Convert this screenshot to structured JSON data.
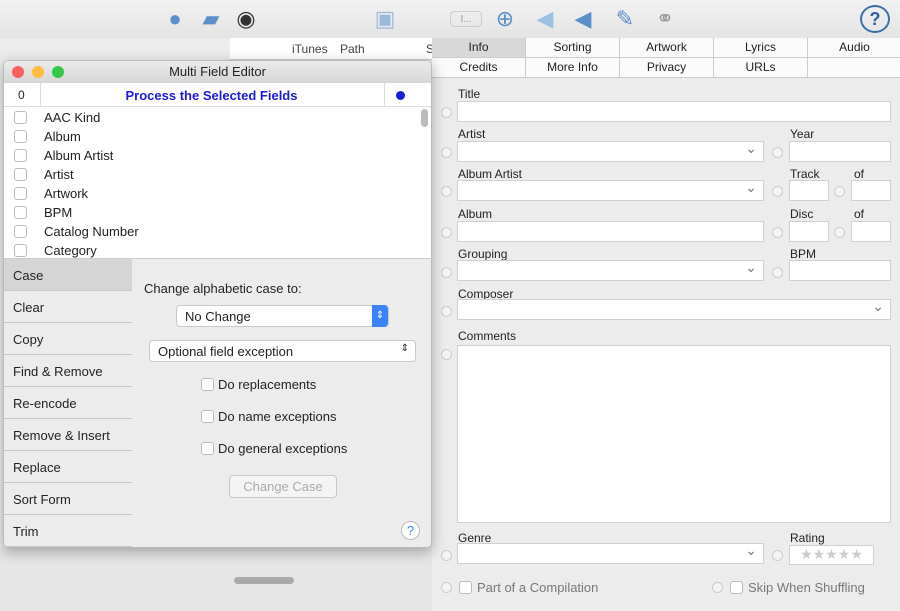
{
  "toolbar": {
    "icons": [
      "globe-icon",
      "folder-icon",
      "cd-icon",
      "save-icon",
      "field-icon",
      "zoom-icon",
      "megaphone-icon",
      "megaphone-edit-icon",
      "pencil-icon",
      "link-icon",
      "help-icon"
    ],
    "field_label": "I..."
  },
  "list_header": {
    "columns": [
      "iTunes",
      "Path",
      "S"
    ]
  },
  "tabs": {
    "row1": [
      "Info",
      "Sorting",
      "Artwork",
      "Lyrics",
      "Audio"
    ],
    "row2": [
      "Credits",
      "More Info",
      "Privacy",
      "URLs"
    ],
    "selected": "Info"
  },
  "info": {
    "title": "Title",
    "artist": "Artist",
    "year": "Year",
    "album_artist": "Album Artist",
    "track": "Track",
    "of1": "of",
    "album": "Album",
    "disc": "Disc",
    "of2": "of",
    "grouping": "Grouping",
    "bpm": "BPM",
    "composer": "Composer",
    "comments": "Comments",
    "genre": "Genre",
    "rating": "Rating",
    "stars": "★★★★★",
    "compilation": "Part of a Compilation",
    "skip": "Skip When Shuffling"
  },
  "dialog": {
    "title": "Multi Field Editor",
    "count": "0",
    "process": "Process the Selected Fields",
    "process_color": "#1a1adb",
    "fields": [
      "AAC Kind",
      "Album",
      "Album Artist",
      "Artist",
      "Artwork",
      "BPM",
      "Catalog Number",
      "Category"
    ],
    "sidebar": [
      "Case",
      "Clear",
      "Copy",
      "Find & Remove",
      "Re-encode",
      "Remove & Insert",
      "Replace",
      "Sort Form",
      "Trim"
    ],
    "selected": "Case",
    "case_label": "Change alphabetic case to:",
    "case_value": "No Change",
    "exception_value": "Optional field exception",
    "do_replacements": "Do replacements",
    "do_name": "Do name exceptions",
    "do_general": "Do general exceptions",
    "change_button": "Change Case",
    "help": "?"
  }
}
